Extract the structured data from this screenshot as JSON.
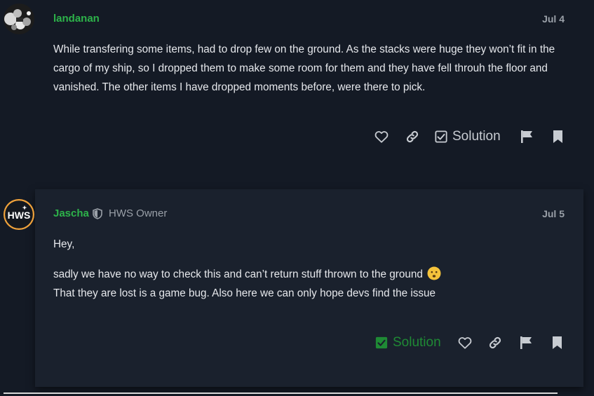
{
  "post1": {
    "username": "landanan",
    "date": "Jul 4",
    "body": "While transfering some items, had to drop few on the ground. As the stacks were huge they won’t fit in the cargo of my ship, so I dropped them to make some room for them and they have fell throuh the floor and vanished. The other items I have dropped moments before, were there to pick.",
    "actions": {
      "solution_label": "Solution"
    }
  },
  "post2": {
    "username": "Jascha",
    "user_title": "HWS Owner",
    "date": "Jul 5",
    "body": {
      "greeting": "Hey,",
      "line1": "sadly we have no way to check this and can’t return stuff thrown to the ground",
      "line2": "That they are lost is a game bug. Also here we can only hope devs find the issue"
    },
    "avatar_text": "HWS",
    "actions": {
      "solution_label": "Solution"
    }
  },
  "colors": {
    "background": "#141a25",
    "username": "#2db34a",
    "accepted_solution": "#1f8a35",
    "icon": "#c8ccd2"
  },
  "icons": {
    "like": "heart-icon",
    "link": "link-icon",
    "solution": "checkbox-icon",
    "flag": "flag-icon",
    "bookmark": "bookmark-icon",
    "staff": "shield-icon"
  }
}
